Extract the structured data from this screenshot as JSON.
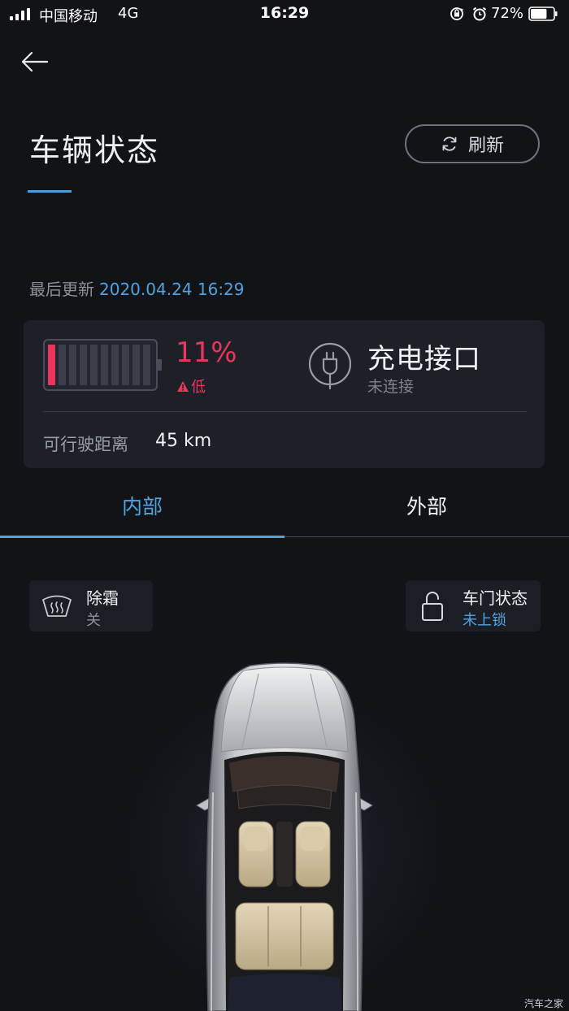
{
  "status_bar": {
    "carrier": "中国移动",
    "network": "4G",
    "time": "16:29",
    "battery_percent": "72%",
    "battery_level": 0.72,
    "signal_bars": 4,
    "icons": [
      "signal-icon",
      "rotation-lock-icon",
      "alarm-icon",
      "battery-icon"
    ]
  },
  "header": {
    "title": "车辆状态",
    "refresh_label": "刷新"
  },
  "last_update": {
    "label": "最后更新",
    "timestamp": "2020.04.24 16:29"
  },
  "vehicle_status": {
    "battery": {
      "percent_label": "11%",
      "level": 0.11,
      "warning": "低",
      "warning_icon": "warning-triangle-icon"
    },
    "charging_port": {
      "title": "充电接口",
      "status": "未连接",
      "icon": "plug-icon"
    },
    "range": {
      "label": "可行驶距离",
      "value": "45 km"
    }
  },
  "tabs": [
    {
      "label": "内部",
      "active": true
    },
    {
      "label": "外部",
      "active": false
    }
  ],
  "interior": {
    "defrost": {
      "title": "除霜",
      "value": "关",
      "icon": "defrost-icon"
    },
    "door": {
      "title": "车门状态",
      "value": "未上锁",
      "icon": "unlocked-padlock-icon"
    }
  },
  "colors": {
    "background": "#121317",
    "accent": "#4fa3df",
    "warning": "#e8365c",
    "card": "#1e2028"
  },
  "watermark": "汽车之家"
}
